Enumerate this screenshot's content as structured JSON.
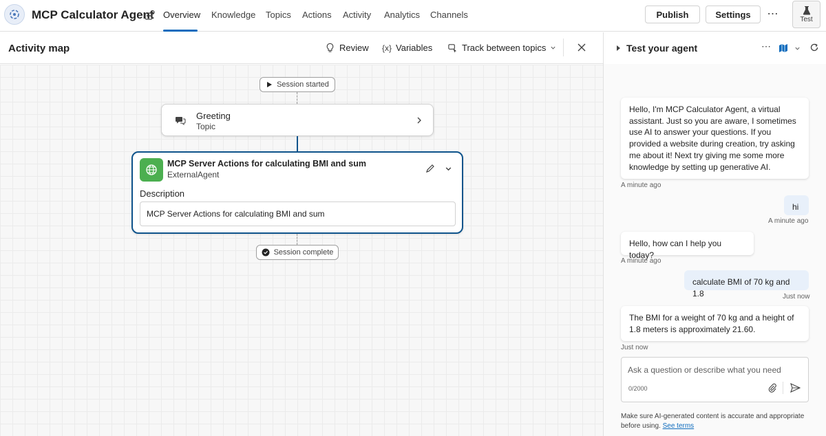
{
  "app": {
    "title": "MCP Calculator Agent"
  },
  "nav": {
    "tabs": [
      "Overview",
      "Knowledge",
      "Topics",
      "Actions",
      "Activity",
      "Analytics",
      "Channels"
    ],
    "active": "Overview"
  },
  "toolbar": {
    "publish_label": "Publish",
    "settings_label": "Settings",
    "test_label": "Test"
  },
  "activity_map": {
    "title": "Activity map",
    "review_label": "Review",
    "variables_label": "Variables",
    "track_label": "Track between topics",
    "session_started": "Session started",
    "session_complete": "Session complete",
    "greeting": {
      "title": "Greeting",
      "subtitle": "Topic"
    },
    "action": {
      "title": "MCP Server Actions for calculating BMI and sum",
      "subtitle": "ExternalAgent",
      "description_label": "Description",
      "description_value": "MCP Server Actions for calculating BMI and sum"
    }
  },
  "test_panel": {
    "title": "Test your agent",
    "messages": [
      {
        "role": "bot",
        "text": "Hello, I'm MCP Calculator Agent, a virtual assistant. Just so you are aware, I sometimes use AI to answer your questions. If you provided a website during creation, try asking me about it! Next try giving me some more knowledge by setting up generative AI.",
        "time": "A minute ago"
      },
      {
        "role": "user",
        "text": "hi",
        "time": "A minute ago"
      },
      {
        "role": "bot",
        "text": "Hello, how can I help you today?",
        "time": "A minute ago"
      },
      {
        "role": "user",
        "text": "calculate BMI of 70 kg and 1.8",
        "time": "Just now"
      },
      {
        "role": "bot",
        "text": "The BMI for a weight of 70 kg and a height of 1.8 meters is approximately 21.60.",
        "time": "Just now"
      }
    ],
    "input_placeholder": "Ask a question or describe what you need",
    "char_count": "0/2000",
    "disclaimer": "Make sure AI-generated content is accurate and appropriate before using.",
    "see_terms": "See terms"
  },
  "colors": {
    "accent": "#0f6cbd",
    "node_border": "#0f548c",
    "action_icon": "#4caf50",
    "user_bubble": "#e8f0fa"
  }
}
